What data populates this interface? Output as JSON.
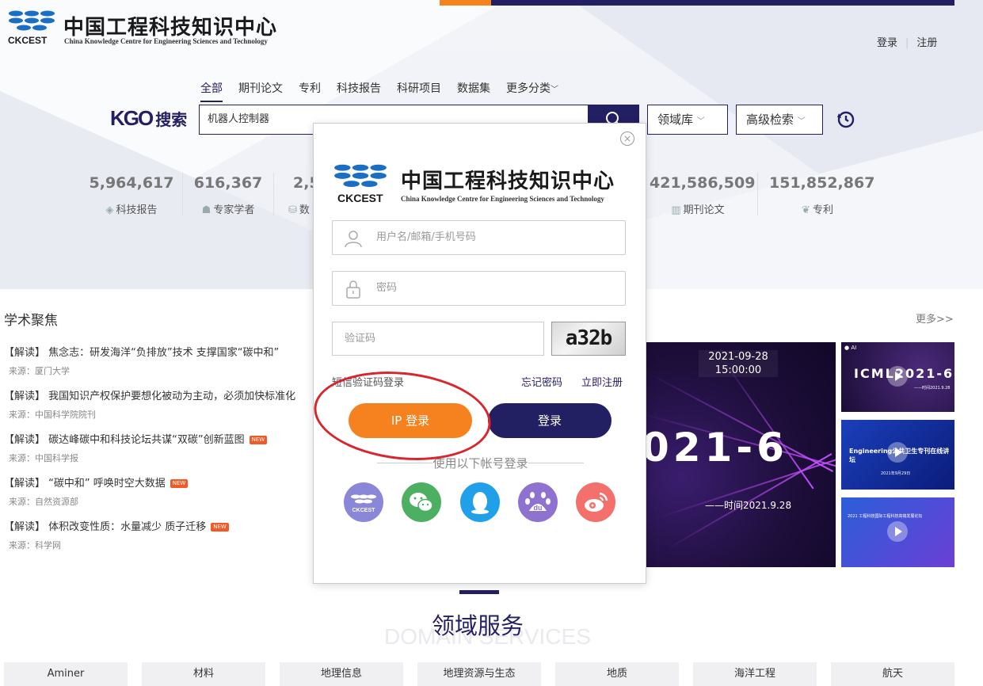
{
  "header": {
    "logo_cn": "中国工程科技知识中心",
    "logo_en": "China Knowledge Centre for Engineering Sciences and Technology",
    "logo_abbr": "CKCEST",
    "login_label": "登录",
    "register_label": "注册"
  },
  "search": {
    "tabs": [
      "全部",
      "期刊论文",
      "专利",
      "科技报告",
      "科研项目",
      "数据集",
      "更多分类"
    ],
    "active_tab": "全部",
    "brand": "KGO",
    "brand_cn": "搜索",
    "query": "机器人控制器",
    "domain_select": "领域库",
    "advanced_select": "高级检索"
  },
  "stats": [
    {
      "value": "5,964,617",
      "label": "科技报告"
    },
    {
      "value": "616,367",
      "label": "专家学者"
    },
    {
      "value": "2,5",
      "label": "数"
    },
    {
      "value": "421,586,509",
      "label": "期刊论文"
    },
    {
      "value": "151,852,867",
      "label": "专利"
    }
  ],
  "academic": {
    "title": "学术聚焦",
    "more": "更多>>",
    "items": [
      {
        "title": "【解读】 焦念志：研发海洋“负排放”技术 支撑国家“碳中和”",
        "source": "来源：厦门大学",
        "is_new": false
      },
      {
        "title": "【解读】 我国知识产权保护要想化被动为主动，必须加快标准化",
        "source": "来源：中国科学院院刊",
        "is_new": false
      },
      {
        "title": "【解读】 碳达峰碳中和科技论坛共谋“双碳”创新蓝图",
        "source": "来源：中国科学报",
        "is_new": true
      },
      {
        "title": "【解读】 “碳中和” 呼唤时空大数据",
        "source": "来源：自然资源部",
        "is_new": true
      },
      {
        "title": "【解读】 体积改变性质：水量减少 质子迁移",
        "source": "来源：科学网",
        "is_new": true
      }
    ],
    "new_badge": "NEW"
  },
  "banner": {
    "date": "2021-09-28",
    "time": "15:00:00",
    "headline": "021-6",
    "caption": "——时间2021.9.28"
  },
  "thumbs": [
    {
      "title": "ICML2021-6",
      "subtitle": "——时间2021.9.28"
    },
    {
      "title": "Engineering公共卫生专刊在线讲坛",
      "subtitle": "2021年9月29日"
    },
    {
      "title": "2021 工程科技国际工程科技高端发展论坛",
      "subtitle": ""
    }
  ],
  "domain_services": {
    "title": "领域服务",
    "subtitle": "DOMAIN SERVICES",
    "items": [
      "Aminer",
      "材料",
      "地理信息",
      "地理资源与生态",
      "地质",
      "海洋工程",
      "航天"
    ]
  },
  "login_modal": {
    "username_placeholder": "用户名/邮箱/手机号码",
    "password_placeholder": "密码",
    "captcha_placeholder": "验证码",
    "captcha_text": "a32b",
    "sms_login": "短信验证码登录",
    "forgot_password": "忘记密码",
    "register_now": "立即注册",
    "ip_login": "IP 登录",
    "login": "登录",
    "other_accounts": "使用以下帐号登录",
    "social": [
      "ckcest",
      "wechat",
      "qq",
      "baidu",
      "weibo"
    ]
  },
  "colors": {
    "brand_navy": "#231f63",
    "accent_orange": "#f5821f",
    "annotation_red": "#d9252e"
  }
}
